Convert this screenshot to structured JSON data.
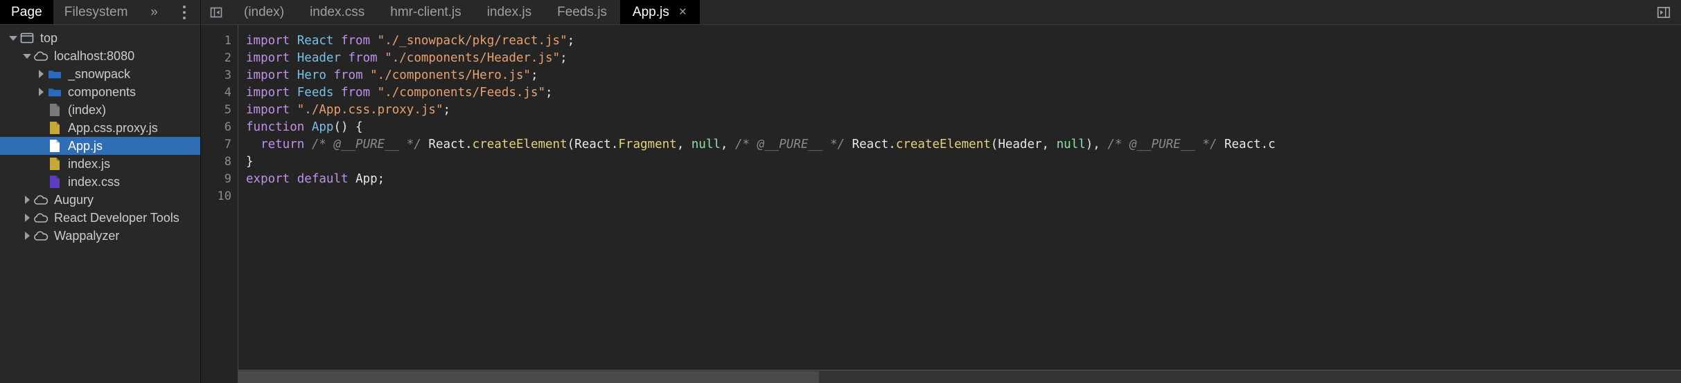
{
  "navigator": {
    "tabs": [
      {
        "label": "Page",
        "active": true
      },
      {
        "label": "Filesystem",
        "active": false
      }
    ],
    "more_label": "»",
    "kebab_name": "more-options",
    "tree": [
      {
        "label": "top",
        "indent": 0,
        "twisty": "down",
        "icon": "frame-icon",
        "selected": false
      },
      {
        "label": "localhost:8080",
        "indent": 1,
        "twisty": "down",
        "icon": "cloud-icon",
        "selected": false
      },
      {
        "label": "_snowpack",
        "indent": 2,
        "twisty": "right",
        "icon": "folder-icon",
        "selected": false
      },
      {
        "label": "components",
        "indent": 2,
        "twisty": "right",
        "icon": "folder-icon",
        "selected": false
      },
      {
        "label": "(index)",
        "indent": 2,
        "twisty": "none",
        "icon": "file-document-icon",
        "selected": false
      },
      {
        "label": "App.css.proxy.js",
        "indent": 2,
        "twisty": "none",
        "icon": "file-js-icon",
        "selected": false
      },
      {
        "label": "App.js",
        "indent": 2,
        "twisty": "none",
        "icon": "file-js-selected-icon",
        "selected": true
      },
      {
        "label": "index.js",
        "indent": 2,
        "twisty": "none",
        "icon": "file-js-icon",
        "selected": false
      },
      {
        "label": "index.css",
        "indent": 2,
        "twisty": "none",
        "icon": "file-css-icon",
        "selected": false
      },
      {
        "label": "Augury",
        "indent": 1,
        "twisty": "right",
        "icon": "cloud-icon",
        "selected": false
      },
      {
        "label": "React Developer Tools",
        "indent": 1,
        "twisty": "right",
        "icon": "cloud-icon",
        "selected": false
      },
      {
        "label": "Wappalyzer",
        "indent": 1,
        "twisty": "right",
        "icon": "cloud-icon",
        "selected": false
      }
    ]
  },
  "editor": {
    "panel_toggle_name": "show-navigator-icon",
    "more_tabs_name": "show-debugger-icon",
    "tabs": [
      {
        "label": "(index)",
        "active": false,
        "closable": false
      },
      {
        "label": "index.css",
        "active": false,
        "closable": false
      },
      {
        "label": "hmr-client.js",
        "active": false,
        "closable": false
      },
      {
        "label": "index.js",
        "active": false,
        "closable": false
      },
      {
        "label": "Feeds.js",
        "active": false,
        "closable": false
      },
      {
        "label": "App.js",
        "active": true,
        "closable": true
      }
    ],
    "close_glyph": "×",
    "line_numbers": [
      "1",
      "2",
      "3",
      "4",
      "5",
      "6",
      "7",
      "8",
      "9",
      "10"
    ],
    "lines": [
      [
        {
          "t": "import ",
          "c": "kw"
        },
        {
          "t": "React",
          "c": "id"
        },
        {
          "t": " from ",
          "c": "kw"
        },
        {
          "t": "\"./_snowpack/pkg/react.js\"",
          "c": "str"
        },
        {
          "t": ";",
          "c": "pln"
        }
      ],
      [
        {
          "t": "import ",
          "c": "kw"
        },
        {
          "t": "Header",
          "c": "id"
        },
        {
          "t": " from ",
          "c": "kw"
        },
        {
          "t": "\"./components/Header.js\"",
          "c": "str"
        },
        {
          "t": ";",
          "c": "pln"
        }
      ],
      [
        {
          "t": "import ",
          "c": "kw"
        },
        {
          "t": "Hero",
          "c": "id"
        },
        {
          "t": " from ",
          "c": "kw"
        },
        {
          "t": "\"./components/Hero.js\"",
          "c": "str"
        },
        {
          "t": ";",
          "c": "pln"
        }
      ],
      [
        {
          "t": "import ",
          "c": "kw"
        },
        {
          "t": "Feeds",
          "c": "id"
        },
        {
          "t": " from ",
          "c": "kw"
        },
        {
          "t": "\"./components/Feeds.js\"",
          "c": "str"
        },
        {
          "t": ";",
          "c": "pln"
        }
      ],
      [
        {
          "t": "import ",
          "c": "kw"
        },
        {
          "t": "\"./App.css.proxy.js\"",
          "c": "str"
        },
        {
          "t": ";",
          "c": "pln"
        }
      ],
      [
        {
          "t": "function ",
          "c": "kw"
        },
        {
          "t": "App",
          "c": "id"
        },
        {
          "t": "() {",
          "c": "pln"
        }
      ],
      [
        {
          "t": "  ",
          "c": "pln"
        },
        {
          "t": "return",
          "c": "kw"
        },
        {
          "t": " ",
          "c": "pln"
        },
        {
          "t": "/* @__PURE__ */",
          "c": "cmt"
        },
        {
          "t": " React.",
          "c": "pln"
        },
        {
          "t": "createElement",
          "c": "fn"
        },
        {
          "t": "(React.",
          "c": "pln"
        },
        {
          "t": "Fragment",
          "c": "fn"
        },
        {
          "t": ", ",
          "c": "pln"
        },
        {
          "t": "null",
          "c": "lit"
        },
        {
          "t": ", ",
          "c": "pln"
        },
        {
          "t": "/* @__PURE__ */",
          "c": "cmt"
        },
        {
          "t": " React.",
          "c": "pln"
        },
        {
          "t": "createElement",
          "c": "fn"
        },
        {
          "t": "(Header, ",
          "c": "pln"
        },
        {
          "t": "null",
          "c": "lit"
        },
        {
          "t": "), ",
          "c": "pln"
        },
        {
          "t": "/* @__PURE__ */",
          "c": "cmt"
        },
        {
          "t": " React.c",
          "c": "pln"
        }
      ],
      [
        {
          "t": "}",
          "c": "pln"
        }
      ],
      [
        {
          "t": "export ",
          "c": "kw"
        },
        {
          "t": "default ",
          "c": "kw"
        },
        {
          "t": "App",
          "c": "pln"
        },
        {
          "t": ";",
          "c": "pln"
        }
      ],
      [
        {
          "t": "",
          "c": "pln"
        }
      ]
    ]
  },
  "colors": {
    "panel_bg": "#282828",
    "editor_bg": "#242424",
    "selection_blue": "#2f6eb5",
    "active_tab_bg": "#000000",
    "text_dim": "#9aa0a6",
    "folder_blue": "#2a6bc0",
    "file_yellow": "#c9a83a",
    "file_purple": "#5b3fc0",
    "file_grey": "#7a7a7a"
  }
}
